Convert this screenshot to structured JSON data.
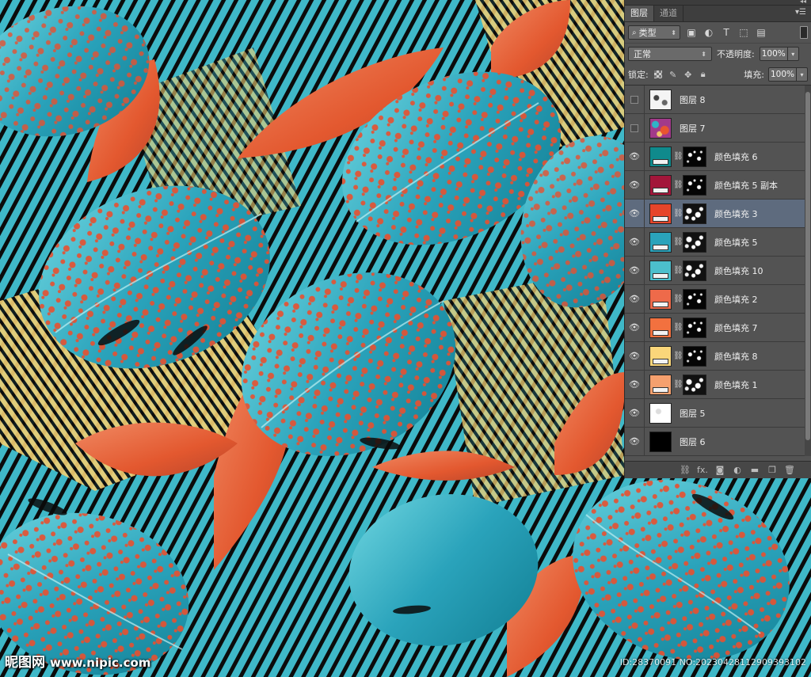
{
  "panel": {
    "tabs": [
      {
        "label": "图层",
        "active": true
      },
      {
        "label": "通道",
        "active": false
      }
    ],
    "filter": {
      "kind_label": "类型",
      "icons": [
        "pixel-filter-icon",
        "adjustment-filter-icon",
        "type-filter-icon",
        "shape-filter-icon",
        "smart-object-filter-icon"
      ]
    },
    "blend_mode": "正常",
    "opacity_label": "不透明度:",
    "opacity_value": "100%",
    "lock_label": "锁定:",
    "fill_label": "填充:",
    "fill_value": "100%"
  },
  "layers": [
    {
      "name": "图层 8",
      "visible": false,
      "type": "pixel",
      "thumb": "pattern-8"
    },
    {
      "name": "图层 7",
      "visible": false,
      "type": "pixel",
      "thumb": "pattern-7"
    },
    {
      "name": "颜色填充 6",
      "visible": true,
      "type": "fill",
      "color": "#0f8a8c",
      "mask": "sparse"
    },
    {
      "name": "颜色填充 5 副本",
      "visible": true,
      "type": "fill",
      "color": "#a3163a",
      "mask": "sparse"
    },
    {
      "name": "颜色填充 3",
      "visible": true,
      "type": "fill",
      "color": "#e6452a",
      "mask": "dense",
      "selected": true
    },
    {
      "name": "颜色填充 5",
      "visible": true,
      "type": "fill",
      "color": "#2aa3bb",
      "mask": "dense"
    },
    {
      "name": "颜色填充 10",
      "visible": true,
      "type": "fill",
      "color": "#4cbfcc",
      "mask": "dense"
    },
    {
      "name": "颜色填充 2",
      "visible": true,
      "type": "fill",
      "color": "#ee6a4a",
      "mask": "sparse"
    },
    {
      "name": "颜色填充 7",
      "visible": true,
      "type": "fill",
      "color": "#f2713f",
      "mask": "sparse"
    },
    {
      "name": "颜色填充 8",
      "visible": true,
      "type": "fill",
      "color": "#fad67a",
      "mask": "sparse"
    },
    {
      "name": "颜色填充 1",
      "visible": true,
      "type": "fill",
      "color": "#f5a06e",
      "mask": "dense"
    },
    {
      "name": "图层 5",
      "visible": true,
      "type": "pixel",
      "thumb": "pattern-5"
    },
    {
      "name": "图层 6",
      "visible": true,
      "type": "pixel",
      "thumb": "black"
    }
  ],
  "footer_icons": [
    "link-layers-icon",
    "fx-icon",
    "add-mask-icon",
    "adjustment-layer-icon",
    "new-group-icon",
    "new-layer-icon",
    "delete-layer-icon"
  ],
  "footer_labels": {
    "fx": "fx."
  },
  "watermark": {
    "site_name": "昵图网",
    "url": "www.nipic.com",
    "id_text": "ID:28370091 NO:20230428112909393102"
  },
  "artwork": {
    "description_colors": {
      "teal": "#3fb8c8",
      "coral": "#e8502f",
      "salmon": "#e57a55",
      "yellow": "#f2cf72",
      "background": "#0b0b0b"
    }
  }
}
